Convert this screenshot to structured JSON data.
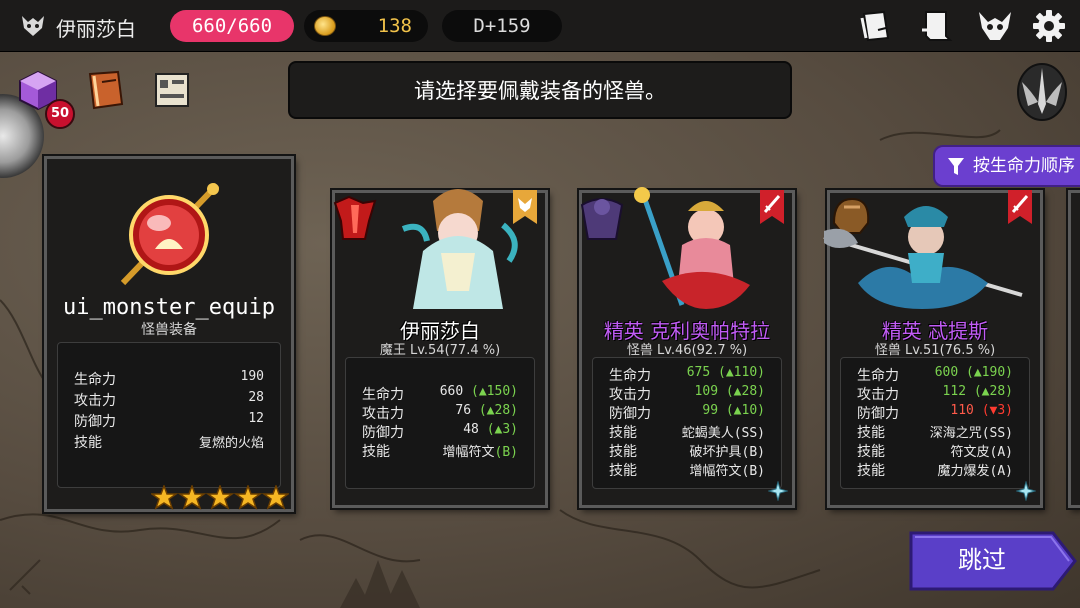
{
  "topbar": {
    "player_name": "伊丽莎白",
    "hp": "660/660",
    "gold": "138",
    "day": "D+159"
  },
  "side": {
    "cube_count": "50"
  },
  "prompt": "请选择要佩戴装备的怪兽。",
  "sort_label": "按生命力顺序",
  "skip_label": "跳过",
  "equip_card": {
    "name": "ui_monster_equip",
    "subtitle": "怪兽装备",
    "stats": [
      {
        "label": "生命力",
        "value": "190"
      },
      {
        "label": "攻击力",
        "value": "28"
      },
      {
        "label": "防御力",
        "value": "12"
      },
      {
        "label": "技能",
        "value": "复燃的火焰"
      }
    ],
    "stars": 5
  },
  "monsters": [
    {
      "name": "伊丽莎白",
      "elite": false,
      "subtitle": "魔王 Lv.54(77.4 %)",
      "stats": [
        {
          "label": "生命力",
          "value": "660 (▲150)",
          "tone": "mixed"
        },
        {
          "label": "攻击力",
          "value": "76 (▲28)",
          "tone": "mixed"
        },
        {
          "label": "防御力",
          "value": "48 (▲3)",
          "tone": "mixed"
        },
        {
          "label": "技能",
          "value": "增幅符文(B)",
          "tone": "plain"
        }
      ]
    },
    {
      "name": "精英 克利奥帕特拉",
      "elite": true,
      "subtitle": "怪兽 Lv.46(92.7 %)",
      "stats": [
        {
          "label": "生命力",
          "value": "675 (▲110)",
          "tone": "green"
        },
        {
          "label": "攻击力",
          "value": "109 (▲28)",
          "tone": "green"
        },
        {
          "label": "防御力",
          "value": "99 (▲10)",
          "tone": "green"
        },
        {
          "label": "技能",
          "value": "蛇蝎美人(SS)",
          "tone": "plain"
        },
        {
          "label": "技能",
          "value": "破坏护具(B)",
          "tone": "plain"
        },
        {
          "label": "技能",
          "value": "增幅符文(B)",
          "tone": "plain"
        }
      ]
    },
    {
      "name": "精英 忒提斯",
      "elite": true,
      "subtitle": "怪兽 Lv.51(76.5 %)",
      "stats": [
        {
          "label": "生命力",
          "value": "600 (▲190)",
          "tone": "green"
        },
        {
          "label": "攻击力",
          "value": "112 (▲28)",
          "tone": "green"
        },
        {
          "label": "防御力",
          "value": "110 (▼3)",
          "tone": "red"
        },
        {
          "label": "技能",
          "value": "深海之咒(SS)",
          "tone": "plain"
        },
        {
          "label": "技能",
          "value": "符文皮(A)",
          "tone": "plain"
        },
        {
          "label": "技能",
          "value": "魔力爆发(A)",
          "tone": "plain"
        }
      ]
    }
  ],
  "colors": {
    "hp_pill": "#e8356a",
    "gold_text": "#f1c24a",
    "elite_name": "#c15cf5",
    "stat_up": "#7bd34f",
    "stat_down": "#ff3b30",
    "sort_tab": "#6b3fcf",
    "skip_button": "#5a3fc8"
  },
  "icons": [
    "demon-head-icon",
    "gold-coin-icon",
    "cards-icon",
    "scroll-icon",
    "horned-skull-icon",
    "gear-icon",
    "purple-cube-icon",
    "spellbook-icon",
    "map-scroll-icon",
    "winged-sword-emblem-icon",
    "filter-icon",
    "star-icon",
    "crystal-icon"
  ]
}
